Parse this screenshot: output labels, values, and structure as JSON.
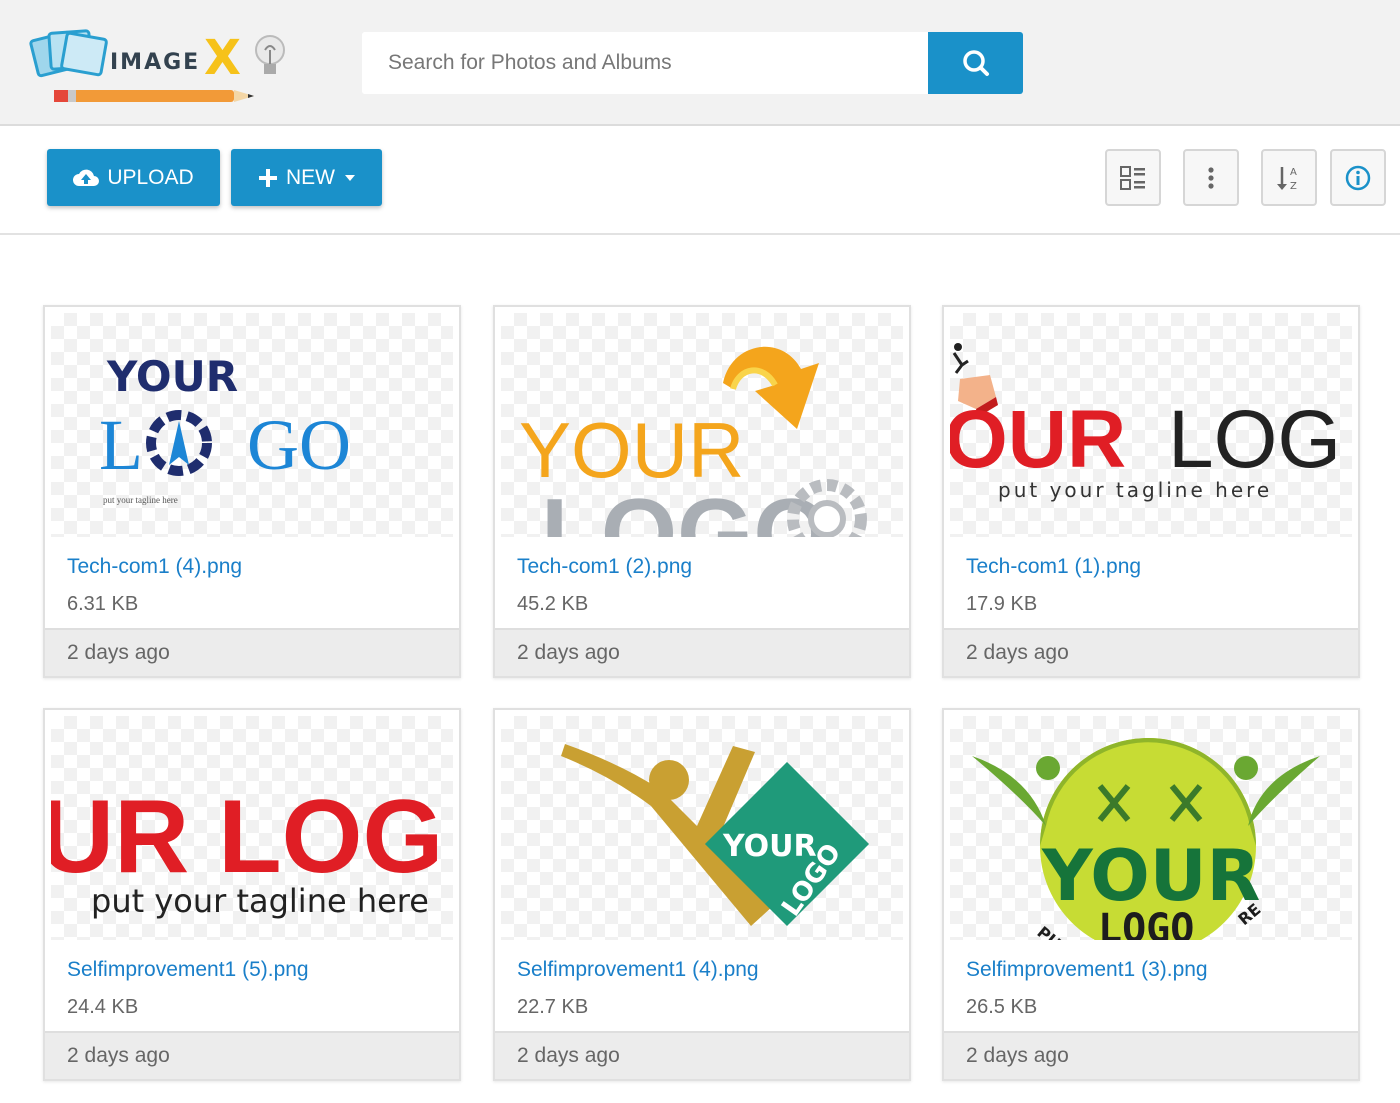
{
  "app": {
    "logo_text": "IMAGE",
    "logo_x": "X"
  },
  "search": {
    "placeholder": "Search for Photos and Albums",
    "value": ""
  },
  "toolbar": {
    "upload_label": "UPLOAD",
    "new_label": "NEW",
    "tools": [
      "grid-view-icon",
      "more-options-icon",
      "sort-alpha-icon",
      "info-icon"
    ]
  },
  "colors": {
    "accent": "#1a91c9",
    "link": "#1a7fc9"
  },
  "files": [
    {
      "name": "Tech-com1 (4).png",
      "size": "6.31 KB",
      "modified": "2 days ago",
      "thumb": {
        "line1": "YOUR",
        "line2a": "L",
        "line2b": "GO",
        "tagline": "put your tagline here"
      }
    },
    {
      "name": "Tech-com1 (2).png",
      "size": "45.2 KB",
      "modified": "2 days ago",
      "thumb": {
        "line1": "YOUR",
        "line2": "LOGO"
      }
    },
    {
      "name": "Tech-com1 (1).png",
      "size": "17.9 KB",
      "modified": "2 days ago",
      "thumb": {
        "line1a": "OUR",
        "line1b": "LOG",
        "tagline": "put your tagline here"
      }
    },
    {
      "name": "Selfimprovement1 (5).png",
      "size": "24.4 KB",
      "modified": "2 days ago",
      "thumb": {
        "line1": "UR LOG",
        "tagline": "put your tagline here"
      }
    },
    {
      "name": "Selfimprovement1 (4).png",
      "size": "22.7 KB",
      "modified": "2 days ago",
      "thumb": {
        "line1": "YOUR",
        "line2": "LOGO"
      }
    },
    {
      "name": "Selfimprovement1 (3).png",
      "size": "26.5 KB",
      "modified": "2 days ago",
      "thumb": {
        "line1": "YOUR",
        "line2": "LOGO",
        "arc_left": "PU",
        "arc_right": "RE"
      }
    }
  ]
}
